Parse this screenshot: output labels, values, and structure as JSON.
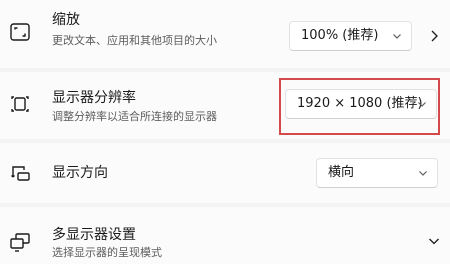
{
  "display_settings": {
    "scale": {
      "title": "缩放",
      "description": "更改文本、应用和其他项目的大小",
      "value": "100% (推荐)",
      "icon": "scale-icon"
    },
    "resolution": {
      "title": "显示器分辨率",
      "description": "调整分辨率以适合所连接的显示器",
      "value": "1920 × 1080 (推荐)",
      "icon": "resolution-icon"
    },
    "orientation": {
      "title": "显示方向",
      "value": "横向",
      "icon": "orientation-icon"
    },
    "multiple_displays": {
      "title": "多显示器设置",
      "description": "选择显示器的呈现模式",
      "icon": "multiple-displays-icon"
    }
  },
  "colors": {
    "highlight": "#d44a4a",
    "row_background": "#fbfbfb",
    "page_background": "#f3f3f3"
  }
}
